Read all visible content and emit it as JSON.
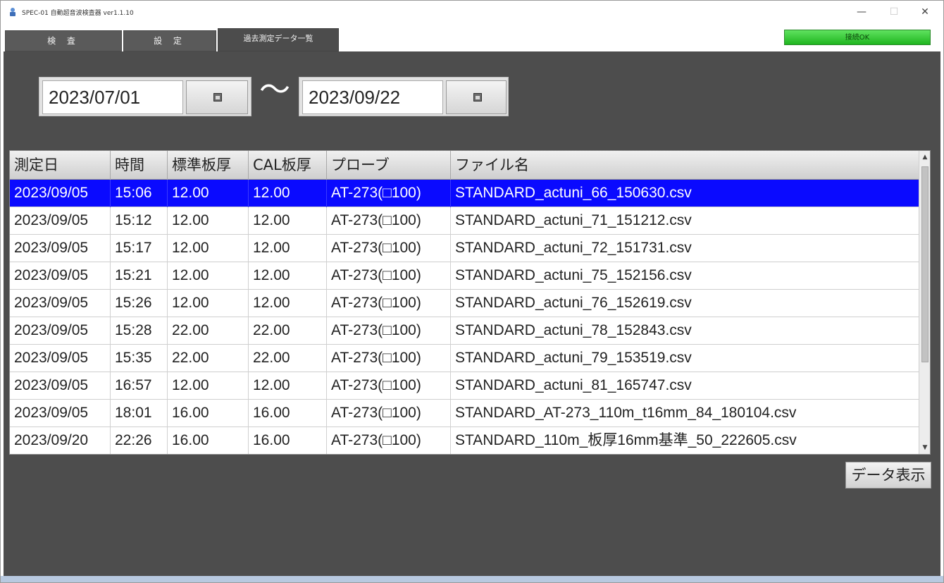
{
  "window": {
    "title": "SPEC-01 自動超音波検査器 ver1.1.10",
    "minimize_glyph": "—",
    "maximize_glyph": "☐",
    "close_glyph": "✕"
  },
  "tabs": [
    {
      "label": "検 査"
    },
    {
      "label": "設 定"
    },
    {
      "label": "過去測定データ一覧"
    }
  ],
  "status": {
    "label": "接続OK",
    "color": "#2ecc2e"
  },
  "date_range": {
    "start": "2023/07/01",
    "end": "2023/09/22",
    "separator": "〜"
  },
  "table": {
    "columns": [
      "測定日",
      "時間",
      "標準板厚",
      "CAL板厚",
      "プローブ",
      "ファイル名"
    ],
    "rows": [
      [
        "2023/09/05",
        "15:06",
        "12.00",
        "12.00",
        "AT-273(□100)",
        "STANDARD_actuni_66_150630.csv"
      ],
      [
        "2023/09/05",
        "15:12",
        "12.00",
        "12.00",
        "AT-273(□100)",
        "STANDARD_actuni_71_151212.csv"
      ],
      [
        "2023/09/05",
        "15:17",
        "12.00",
        "12.00",
        "AT-273(□100)",
        "STANDARD_actuni_72_151731.csv"
      ],
      [
        "2023/09/05",
        "15:21",
        "12.00",
        "12.00",
        "AT-273(□100)",
        "STANDARD_actuni_75_152156.csv"
      ],
      [
        "2023/09/05",
        "15:26",
        "12.00",
        "12.00",
        "AT-273(□100)",
        "STANDARD_actuni_76_152619.csv"
      ],
      [
        "2023/09/05",
        "15:28",
        "22.00",
        "22.00",
        "AT-273(□100)",
        "STANDARD_actuni_78_152843.csv"
      ],
      [
        "2023/09/05",
        "15:35",
        "22.00",
        "22.00",
        "AT-273(□100)",
        "STANDARD_actuni_79_153519.csv"
      ],
      [
        "2023/09/05",
        "16:57",
        "12.00",
        "12.00",
        "AT-273(□100)",
        "STANDARD_actuni_81_165747.csv"
      ],
      [
        "2023/09/05",
        "18:01",
        "16.00",
        "16.00",
        "AT-273(□100)",
        "STANDARD_AT-273_110m_t16mm_84_180104.csv"
      ],
      [
        "2023/09/20",
        "22:26",
        "16.00",
        "16.00",
        "AT-273(□100)",
        "STANDARD_110m_板厚16mm基準_50_222605.csv"
      ]
    ],
    "selected_row": 0,
    "selection_color": "#0a0aff"
  },
  "scroll": {
    "up_glyph": "▲",
    "down_glyph": "▼"
  },
  "buttons": {
    "show_data": "データ表示"
  }
}
